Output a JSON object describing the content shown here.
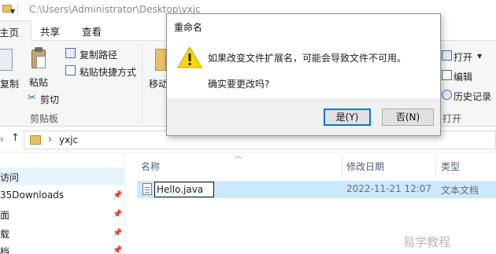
{
  "window": {
    "path": "C:\\Users\\Administrator\\Desktop\\yxjc"
  },
  "ribbon": {
    "tabs": [
      {
        "label": "主页"
      },
      {
        "label": "共享"
      },
      {
        "label": "查看"
      }
    ],
    "clipboard": {
      "copy": "复制",
      "paste": "粘贴",
      "copy_path": "复制路径",
      "paste_shortcut": "粘贴快捷方式",
      "cut": "剪切",
      "group": "剪贴板"
    },
    "organize": {
      "move": "移动"
    },
    "open": {
      "open": "打开",
      "edit": "编辑",
      "history": "历史记录",
      "group": "打开"
    }
  },
  "address": {
    "crumb": "yxjc"
  },
  "nav": {
    "items": [
      {
        "label": "访问"
      },
      {
        "label": "35Downloads"
      },
      {
        "label": "面"
      },
      {
        "label": "载"
      },
      {
        "label": "档"
      }
    ]
  },
  "file_list": {
    "columns": [
      {
        "label": "名称"
      },
      {
        "label": "修改日期"
      },
      {
        "label": "类型"
      }
    ],
    "rows": [
      {
        "name": "Hello.java",
        "modified": "2022-11-21 12:07",
        "type": "文本文档"
      }
    ]
  },
  "dialog": {
    "title": "重命名",
    "message": "如果改变文件扩展名，可能会导致文件不可用。",
    "question": "确实要更改吗?",
    "yes_label": "是(Y)",
    "no_label": "否(N)"
  },
  "watermark": "易学教程",
  "colors": {
    "selection": "#cce8ff",
    "accent": "#0078d7",
    "warning": "#ffd700"
  }
}
